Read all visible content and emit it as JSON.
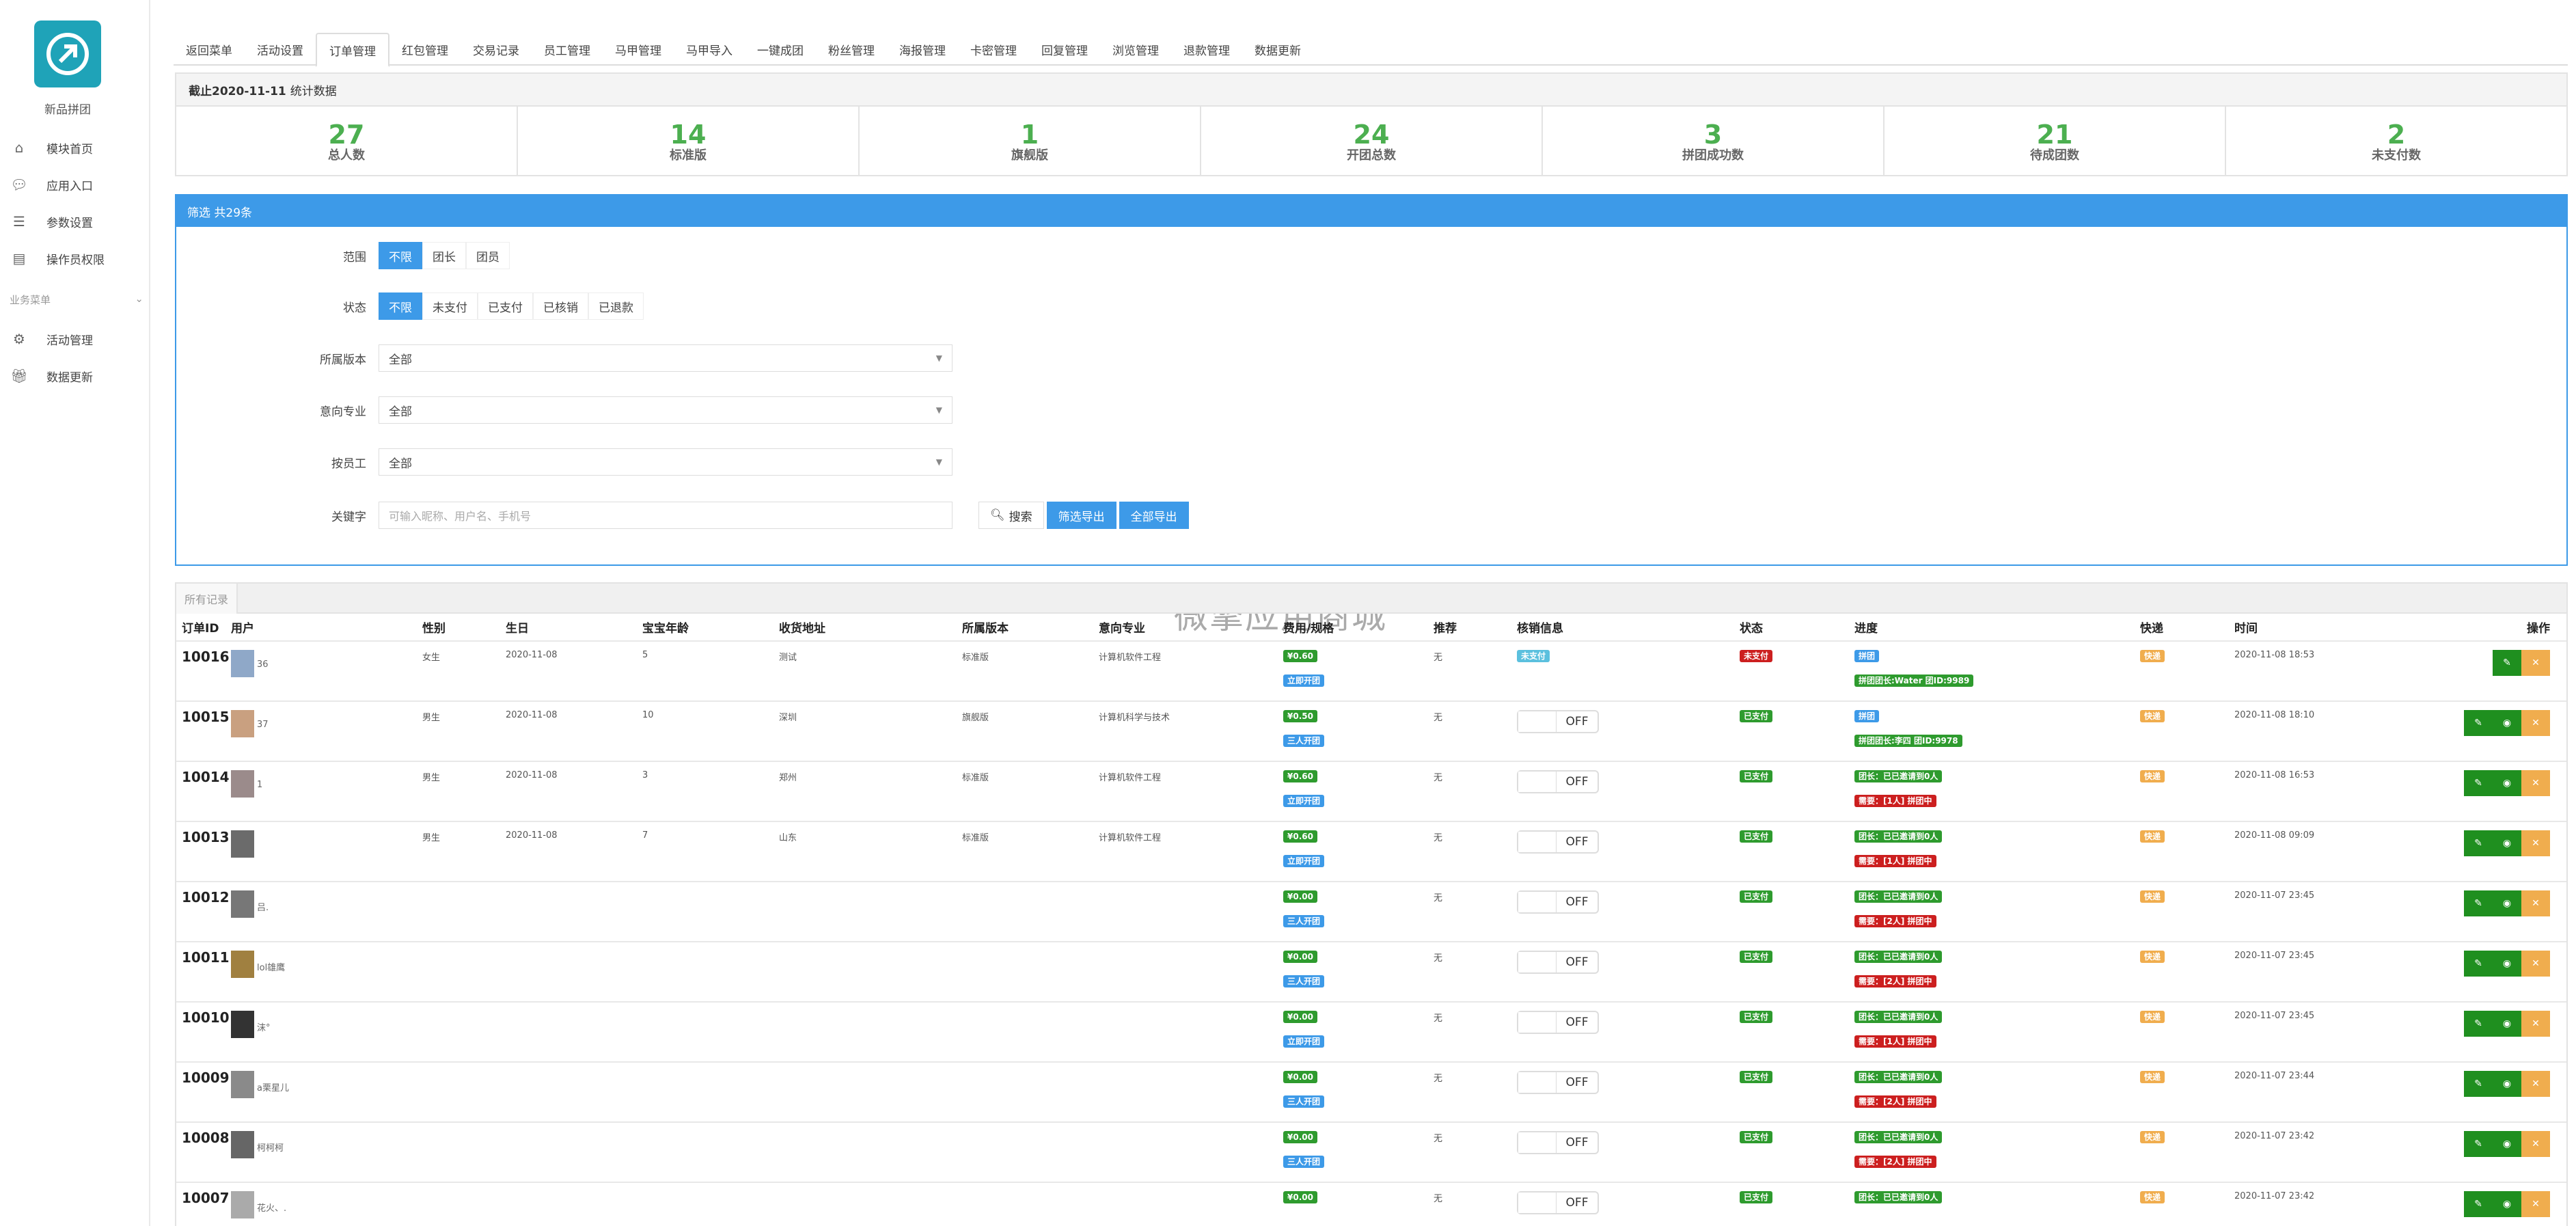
{
  "sidebar": {
    "app_name": "新品拼团",
    "items": [
      {
        "icon": "home-icon",
        "label": "模块首页"
      },
      {
        "icon": "chat-icon",
        "label": "应用入口"
      },
      {
        "icon": "list-icon",
        "label": "参数设置"
      },
      {
        "icon": "document-lock-icon",
        "label": "操作员权限"
      }
    ],
    "section_title": "业务菜单",
    "section_items": [
      {
        "icon": "gear-icon",
        "label": "活动管理"
      },
      {
        "icon": "gift-icon",
        "label": "数据更新"
      }
    ]
  },
  "topnav": {
    "tabs": [
      "返回菜单",
      "活动设置",
      "订单管理",
      "红包管理",
      "交易记录",
      "员工管理",
      "马甲管理",
      "马甲导入",
      "一键成团",
      "粉丝管理",
      "海报管理",
      "卡密管理",
      "回复管理",
      "浏览管理",
      "退款管理",
      "数据更新"
    ],
    "active": "订单管理"
  },
  "stats": {
    "date_label": "截止2020-11-11",
    "suffix": "统计数据",
    "items": [
      {
        "value": "27",
        "label": "总人数"
      },
      {
        "value": "14",
        "label": "标准版"
      },
      {
        "value": "1",
        "label": "旗舰版"
      },
      {
        "value": "24",
        "label": "开团总数"
      },
      {
        "value": "3",
        "label": "拼团成功数"
      },
      {
        "value": "21",
        "label": "待成团数"
      },
      {
        "value": "2",
        "label": "未支付数"
      }
    ]
  },
  "filter": {
    "title": "筛选 共29条",
    "range": {
      "label": "范围",
      "options": [
        "不限",
        "团长",
        "团员"
      ],
      "selected": "不限"
    },
    "status": {
      "label": "状态",
      "options": [
        "不限",
        "未支付",
        "已支付",
        "已核销",
        "已退款"
      ],
      "selected": "不限"
    },
    "version": {
      "label": "所属版本",
      "value": "全部"
    },
    "major": {
      "label": "意向专业",
      "value": "全部"
    },
    "staff": {
      "label": "按员工",
      "value": "全部"
    },
    "keyword": {
      "label": "关键字",
      "placeholder": "可输入昵称、用户名、手机号"
    },
    "search_label": "搜索",
    "export_filtered": "筛选导出",
    "export_all": "全部导出"
  },
  "records": {
    "tab_label": "所有记录",
    "watermark": "微擎应用商城",
    "columns": [
      "订单ID",
      "用户",
      "性别",
      "生日",
      "宝宝年龄",
      "收货地址",
      "所属版本",
      "意向专业",
      "费用/规格",
      "推荐",
      "核销信息",
      "状态",
      "进度",
      "快递",
      "时间",
      "操作"
    ],
    "rows": [
      {
        "id": "10016",
        "user": "36",
        "gender": "女生",
        "birthday": "2020-11-08",
        "age": "5",
        "address": "测试",
        "version": "标准版",
        "major": "计算机软件工程",
        "fee": "¥0.60",
        "spec": "立即开团",
        "recommend": "无",
        "verify": "未支付",
        "verify_type": "badge",
        "status": "未支付",
        "status_color": "r",
        "progress": [
          "拼团"
        ],
        "progress_colors": [
          "b"
        ],
        "progress_extra": "拼团团长:Water 团ID:9989",
        "express": "快递",
        "time": "2020-11-08 18:53",
        "ops": 2
      },
      {
        "id": "10015",
        "user": "37",
        "gender": "男生",
        "birthday": "2020-11-08",
        "age": "10",
        "address": "深圳",
        "version": "旗舰版",
        "major": "计算机科学与技术",
        "fee": "¥0.50",
        "spec": "三人开团",
        "recommend": "无",
        "verify": "OFF",
        "verify_type": "toggle",
        "status": "已支付",
        "status_color": "g",
        "progress": [
          "拼团"
        ],
        "progress_colors": [
          "b"
        ],
        "progress_extra": "拼团团长:李四 团ID:9978",
        "express": "快递",
        "time": "2020-11-08 18:10",
        "ops": 3
      },
      {
        "id": "10014",
        "user": "1",
        "gender": "男生",
        "birthday": "2020-11-08",
        "age": "3",
        "address": "郑州",
        "version": "标准版",
        "major": "计算机软件工程",
        "fee": "¥0.60",
        "spec": "立即开团",
        "recommend": "无",
        "verify": "OFF",
        "verify_type": "toggle",
        "status": "已支付",
        "status_color": "g",
        "progress": [
          "团长：已已邀请到0人"
        ],
        "progress_colors": [
          "g"
        ],
        "progress_extra": "需要：[1人] 拼团中",
        "express": "快递",
        "time": "2020-11-08 16:53",
        "ops": 3
      },
      {
        "id": "10013",
        "user": "",
        "gender": "男生",
        "birthday": "2020-11-08",
        "age": "7",
        "address": "山东",
        "version": "标准版",
        "major": "计算机软件工程",
        "fee": "¥0.60",
        "spec": "立即开团",
        "recommend": "无",
        "verify": "OFF",
        "verify_type": "toggle",
        "status": "已支付",
        "status_color": "g",
        "progress": [
          "团长：已已邀请到0人"
        ],
        "progress_colors": [
          "g"
        ],
        "progress_extra": "需要：[1人] 拼团中",
        "express": "快递",
        "time": "2020-11-08 09:09",
        "ops": 3
      },
      {
        "id": "10012",
        "user": "吕.",
        "gender": "",
        "birthday": "",
        "age": "",
        "address": "",
        "version": "",
        "major": "",
        "fee": "¥0.00",
        "spec": "三人开团",
        "recommend": "无",
        "verify": "OFF",
        "verify_type": "toggle",
        "status": "已支付",
        "status_color": "g",
        "progress": [
          "团长：已已邀请到0人"
        ],
        "progress_colors": [
          "g"
        ],
        "progress_extra": "需要：[2人] 拼团中",
        "express": "快递",
        "time": "2020-11-07 23:45",
        "ops": 3
      },
      {
        "id": "10011",
        "user": "lol雄鹰",
        "gender": "",
        "birthday": "",
        "age": "",
        "address": "",
        "version": "",
        "major": "",
        "fee": "¥0.00",
        "spec": "三人开团",
        "recommend": "无",
        "verify": "OFF",
        "verify_type": "toggle",
        "status": "已支付",
        "status_color": "g",
        "progress": [
          "团长：已已邀请到0人"
        ],
        "progress_colors": [
          "g"
        ],
        "progress_extra": "需要：[2人] 拼团中",
        "express": "快递",
        "time": "2020-11-07 23:45",
        "ops": 3
      },
      {
        "id": "10010",
        "user": "沫°",
        "gender": "",
        "birthday": "",
        "age": "",
        "address": "",
        "version": "",
        "major": "",
        "fee": "¥0.00",
        "spec": "立即开团",
        "recommend": "无",
        "verify": "OFF",
        "verify_type": "toggle",
        "status": "已支付",
        "status_color": "g",
        "progress": [
          "团长：已已邀请到0人"
        ],
        "progress_colors": [
          "g"
        ],
        "progress_extra": "需要：[1人] 拼团中",
        "express": "快递",
        "time": "2020-11-07 23:45",
        "ops": 3
      },
      {
        "id": "10009",
        "user": "a栗星儿",
        "gender": "",
        "birthday": "",
        "age": "",
        "address": "",
        "version": "",
        "major": "",
        "fee": "¥0.00",
        "spec": "三人开团",
        "recommend": "无",
        "verify": "OFF",
        "verify_type": "toggle",
        "status": "已支付",
        "status_color": "g",
        "progress": [
          "团长：已已邀请到0人"
        ],
        "progress_colors": [
          "g"
        ],
        "progress_extra": "需要：[2人] 拼团中",
        "express": "快递",
        "time": "2020-11-07 23:44",
        "ops": 3
      },
      {
        "id": "10008",
        "user": "柯柯柯",
        "gender": "",
        "birthday": "",
        "age": "",
        "address": "",
        "version": "",
        "major": "",
        "fee": "¥0.00",
        "spec": "三人开团",
        "recommend": "无",
        "verify": "OFF",
        "verify_type": "toggle",
        "status": "已支付",
        "status_color": "g",
        "progress": [
          "团长：已已邀请到0人"
        ],
        "progress_colors": [
          "g"
        ],
        "progress_extra": "需要：[2人] 拼团中",
        "express": "快递",
        "time": "2020-11-07 23:42",
        "ops": 3
      },
      {
        "id": "10007",
        "user": "花火、.",
        "gender": "",
        "birthday": "",
        "age": "",
        "address": "",
        "version": "",
        "major": "",
        "fee": "¥0.00",
        "spec": "",
        "recommend": "无",
        "verify": "OFF",
        "verify_type": "toggle",
        "status": "已支付",
        "status_color": "g",
        "progress": [
          "团长：已已邀请到0人"
        ],
        "progress_colors": [
          "g"
        ],
        "progress_extra": "",
        "express": "快递",
        "time": "2020-11-07 23:42",
        "ops": 3
      }
    ]
  },
  "colors": {
    "accent": "#3d9ae8",
    "stat_number": "#4caf50",
    "success": "#2e9b2e",
    "danger": "#cc1f1f",
    "warning": "#f0ad4e",
    "logo": "#1fa3b8"
  }
}
